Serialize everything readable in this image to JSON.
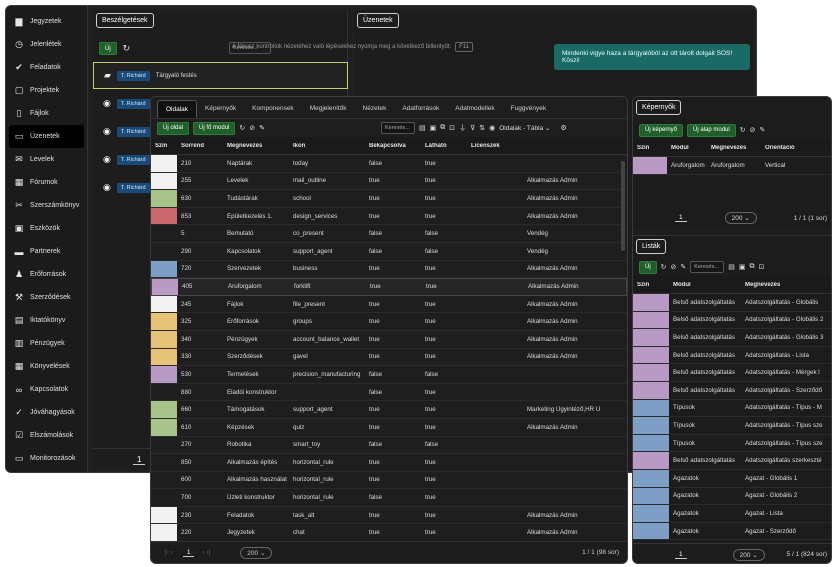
{
  "sidebar": {
    "items": [
      {
        "label": "Jegyzetek",
        "icon": "note-icon"
      },
      {
        "label": "Jelenlétek",
        "icon": "clock-icon"
      },
      {
        "label": "Feladatok",
        "icon": "check-icon"
      },
      {
        "label": "Projektek",
        "icon": "clipboard-icon"
      },
      {
        "label": "Fájlok",
        "icon": "file-icon"
      },
      {
        "label": "Üzenetek",
        "icon": "chat-icon",
        "active": true
      },
      {
        "label": "Levelek",
        "icon": "mail-icon"
      },
      {
        "label": "Fórumok",
        "icon": "forum-icon"
      },
      {
        "label": "Szerszámkönyv",
        "icon": "tool-icon"
      },
      {
        "label": "Eszközök",
        "icon": "device-icon"
      },
      {
        "label": "Partnerek",
        "icon": "truck-icon"
      },
      {
        "label": "Erőforrások",
        "icon": "people-icon"
      },
      {
        "label": "Szerződések",
        "icon": "gavel-icon"
      },
      {
        "label": "Iktatókönyv",
        "icon": "book-icon"
      },
      {
        "label": "Pénzügyek",
        "icon": "money-icon"
      },
      {
        "label": "Könyvelések",
        "icon": "grid-icon"
      },
      {
        "label": "Kapcsolatok",
        "icon": "link-icon"
      },
      {
        "label": "Jóváhagyások",
        "icon": "approve-icon"
      },
      {
        "label": "Elszámolások",
        "icon": "checkbox-icon"
      },
      {
        "label": "Monitorozások",
        "icon": "monitor-icon"
      }
    ]
  },
  "conversations": {
    "title": "Beszélgetések",
    "new_label": "Új",
    "search_placeholder": "Keresés...",
    "rows": [
      {
        "tag": "T. Richárd",
        "text": "Tárgyaló festés"
      },
      {
        "tag": "T. Richárd",
        "text": ""
      },
      {
        "tag": "T. Richárd",
        "text": ""
      },
      {
        "tag": "T. Richárd",
        "text": ""
      },
      {
        "tag": "T. Richárd",
        "text": ""
      }
    ],
    "page": "1"
  },
  "messages": {
    "title": "Üzenetek",
    "hint": "A fókusz kontrollok nézetéhez való lépésekhez nyomja meg a következő billentyűt:",
    "hint_key": "F11",
    "bubble": "Mindenki vigye haza a tárgyalóból az ott tárolt dolgait SOS! Köszi!"
  },
  "main": {
    "tabs": [
      "Oldalak",
      "Képernyők",
      "Komponensek",
      "Megjelenítők",
      "Nézetek",
      "Adatforrások",
      "Adatmodellek",
      "Fuggvények"
    ],
    "new_page": "Új oldal",
    "new_module": "Új fő modul",
    "search_placeholder": "Keresés...",
    "view_select": "Oldalak - Tábla",
    "columns": [
      "Szín",
      "Sorrend",
      "Megnevezés",
      "Ikon",
      "Bekapcsolva",
      "Látható",
      "Licenszek",
      ""
    ],
    "rows": [
      {
        "color": "#f2f2f2",
        "order": "210",
        "name": "Naptárak",
        "icon": "today",
        "on": "false",
        "vis": "true",
        "lic": "",
        "role": ""
      },
      {
        "color": "#f2f2f2",
        "order": "255",
        "name": "Levelek",
        "icon": "mail_outline",
        "on": "true",
        "vis": "true",
        "lic": "",
        "role": "Alkalmazás Admin"
      },
      {
        "color": "#a6c48a",
        "order": "630",
        "name": "Tudástárak",
        "icon": "school",
        "on": "true",
        "vis": "true",
        "lic": "",
        "role": "Alkalmazás Admin"
      },
      {
        "color": "#c9666e",
        "order": "853",
        "name": "Épületkezelés 1.",
        "icon": "design_services",
        "on": "true",
        "vis": "true",
        "lic": "",
        "role": "Alkalmazás Admin"
      },
      {
        "color": "",
        "order": "5",
        "name": "Bemutató",
        "icon": "co_present",
        "on": "false",
        "vis": "false",
        "lic": "",
        "role": "Vendég"
      },
      {
        "color": "",
        "order": "290",
        "name": "Kapcsolatok",
        "icon": "support_agent",
        "on": "false",
        "vis": "false",
        "lic": "",
        "role": "Vendég"
      },
      {
        "color": "#7e9fc5",
        "order": "720",
        "name": "Szervezetek",
        "icon": "business",
        "on": "true",
        "vis": "true",
        "lic": "",
        "role": "Alkalmazás Admin"
      },
      {
        "color": "#b89ac4",
        "order": "405",
        "name": "Áruforgalom",
        "icon": "forklift",
        "on": "true",
        "vis": "true",
        "lic": "",
        "role": "Alkalmazás Admin",
        "sel": true
      },
      {
        "color": "#f2f2f2",
        "order": "245",
        "name": "Fájlok",
        "icon": "file_present",
        "on": "true",
        "vis": "true",
        "lic": "",
        "role": "Alkalmazás Admin"
      },
      {
        "color": "#e7c37a",
        "order": "325",
        "name": "Erőforrások",
        "icon": "groups",
        "on": "true",
        "vis": "true",
        "lic": "",
        "role": "Alkalmazás Admin"
      },
      {
        "color": "#e7c37a",
        "order": "340",
        "name": "Pénzügyek",
        "icon": "account_balance_wallet",
        "on": "true",
        "vis": "true",
        "lic": "",
        "role": "Alkalmazás Admin"
      },
      {
        "color": "#e7c37a",
        "order": "330",
        "name": "Szerződések",
        "icon": "gavel",
        "on": "true",
        "vis": "true",
        "lic": "",
        "role": "Alkalmazás Admin"
      },
      {
        "color": "#b89ac4",
        "order": "530",
        "name": "Termelések",
        "icon": "precision_manufacturing",
        "on": "false",
        "vis": "false",
        "lic": "",
        "role": ""
      },
      {
        "color": "",
        "order": "880",
        "name": "Eladói konstruktor",
        "icon": "",
        "on": "false",
        "vis": "true",
        "lic": "",
        "role": ""
      },
      {
        "color": "#a6c48a",
        "order": "660",
        "name": "Támogatások",
        "icon": "support_agent",
        "on": "true",
        "vis": "true",
        "lic": "",
        "role": "Marketing Ügyintéző,HR Ü"
      },
      {
        "color": "#a6c48a",
        "order": "610",
        "name": "Képzések",
        "icon": "quiz",
        "on": "true",
        "vis": "true",
        "lic": "",
        "role": "Alkalmazás Admin"
      },
      {
        "color": "",
        "order": "270",
        "name": "Robotika",
        "icon": "smart_toy",
        "on": "false",
        "vis": "false",
        "lic": "",
        "role": ""
      },
      {
        "color": "",
        "order": "850",
        "name": "Alkalmazás építés",
        "icon": "horizontal_rule",
        "on": "true",
        "vis": "true",
        "lic": "",
        "role": ""
      },
      {
        "color": "",
        "order": "600",
        "name": "Alkalmazás használat",
        "icon": "horizontal_rule",
        "on": "true",
        "vis": "true",
        "lic": "",
        "role": ""
      },
      {
        "color": "",
        "order": "700",
        "name": "Üzleti konstruktor",
        "icon": "horizontal_rule",
        "on": "false",
        "vis": "true",
        "lic": "",
        "role": ""
      },
      {
        "color": "#f2f2f2",
        "order": "230",
        "name": "Feladatok",
        "icon": "task_alt",
        "on": "true",
        "vis": "true",
        "lic": "",
        "role": "Alkalmazás Admin"
      },
      {
        "color": "#f2f2f2",
        "order": "220",
        "name": "Jegyzetek",
        "icon": "chat",
        "on": "true",
        "vis": "true",
        "lic": "",
        "role": "Alkalmazás Admin"
      }
    ],
    "page": "1",
    "page_size": "200",
    "summary": "1 / 1 (98 sor)"
  },
  "screens": {
    "title": "Képernyők",
    "new_screen": "Új képernyő",
    "new_module": "Új alap modul",
    "columns": [
      "Szín",
      "Modul",
      "Megnevezés",
      "Orientáció"
    ],
    "rows": [
      {
        "color": "#b89ac4",
        "module": "Áruforgalom",
        "name": "Áruforgalom",
        "orient": "Vertical"
      }
    ],
    "page": "1",
    "page_size": "200",
    "summary": "1 / 1 (1 sor)"
  },
  "lists": {
    "title": "Listák",
    "new_label": "Új",
    "search_placeholder": "Keresés...",
    "columns": [
      "Szín",
      "Modul",
      "Megnevezés"
    ],
    "rows": [
      {
        "color": "#b89ac4",
        "module": "Belső adatszolgáltatás",
        "name": "Adatszolgáltatás - Globális"
      },
      {
        "color": "#b89ac4",
        "module": "Belső adatszolgáltatás",
        "name": "Adatszolgáltatás - Globális 2"
      },
      {
        "color": "#b89ac4",
        "module": "Belső adatszolgáltatás",
        "name": "Adatszolgáltatás - Globális 3"
      },
      {
        "color": "#b89ac4",
        "module": "Belső adatszolgáltatás",
        "name": "Adatszolgáltatás - Lista"
      },
      {
        "color": "#b89ac4",
        "module": "Belső adatszolgáltatás",
        "name": "Adatszolgáltatás - Mérgek l"
      },
      {
        "color": "#b89ac4",
        "module": "Belső adatszolgáltatás",
        "name": "Adatszolgáltatás - Szerződő"
      },
      {
        "color": "#7e9fc5",
        "module": "Típusok",
        "name": "Adatszolgáltatás - Típus - M"
      },
      {
        "color": "#7e9fc5",
        "module": "Típusok",
        "name": "Adatszolgáltatás - Típus sze"
      },
      {
        "color": "#7e9fc5",
        "module": "Típusok",
        "name": "Adatszolgáltatás - Típus sze"
      },
      {
        "color": "#b89ac4",
        "module": "Belső adatszolgáltatás",
        "name": "Adatszolgáltatás szerkeszté"
      },
      {
        "color": "#7e9fc5",
        "module": "Ágazatok",
        "name": "Ágazat - Globális 1"
      },
      {
        "color": "#7e9fc5",
        "module": "Ágazatok",
        "name": "Ágazat - Globális 2"
      },
      {
        "color": "#7e9fc5",
        "module": "Ágazatok",
        "name": "Ágazat - Lista"
      },
      {
        "color": "#7e9fc5",
        "module": "Ágazatok",
        "name": "Ágazat - Szerződő"
      }
    ],
    "page": "1",
    "page_size": "200",
    "summary": "5 / 1 (824 sor)"
  }
}
